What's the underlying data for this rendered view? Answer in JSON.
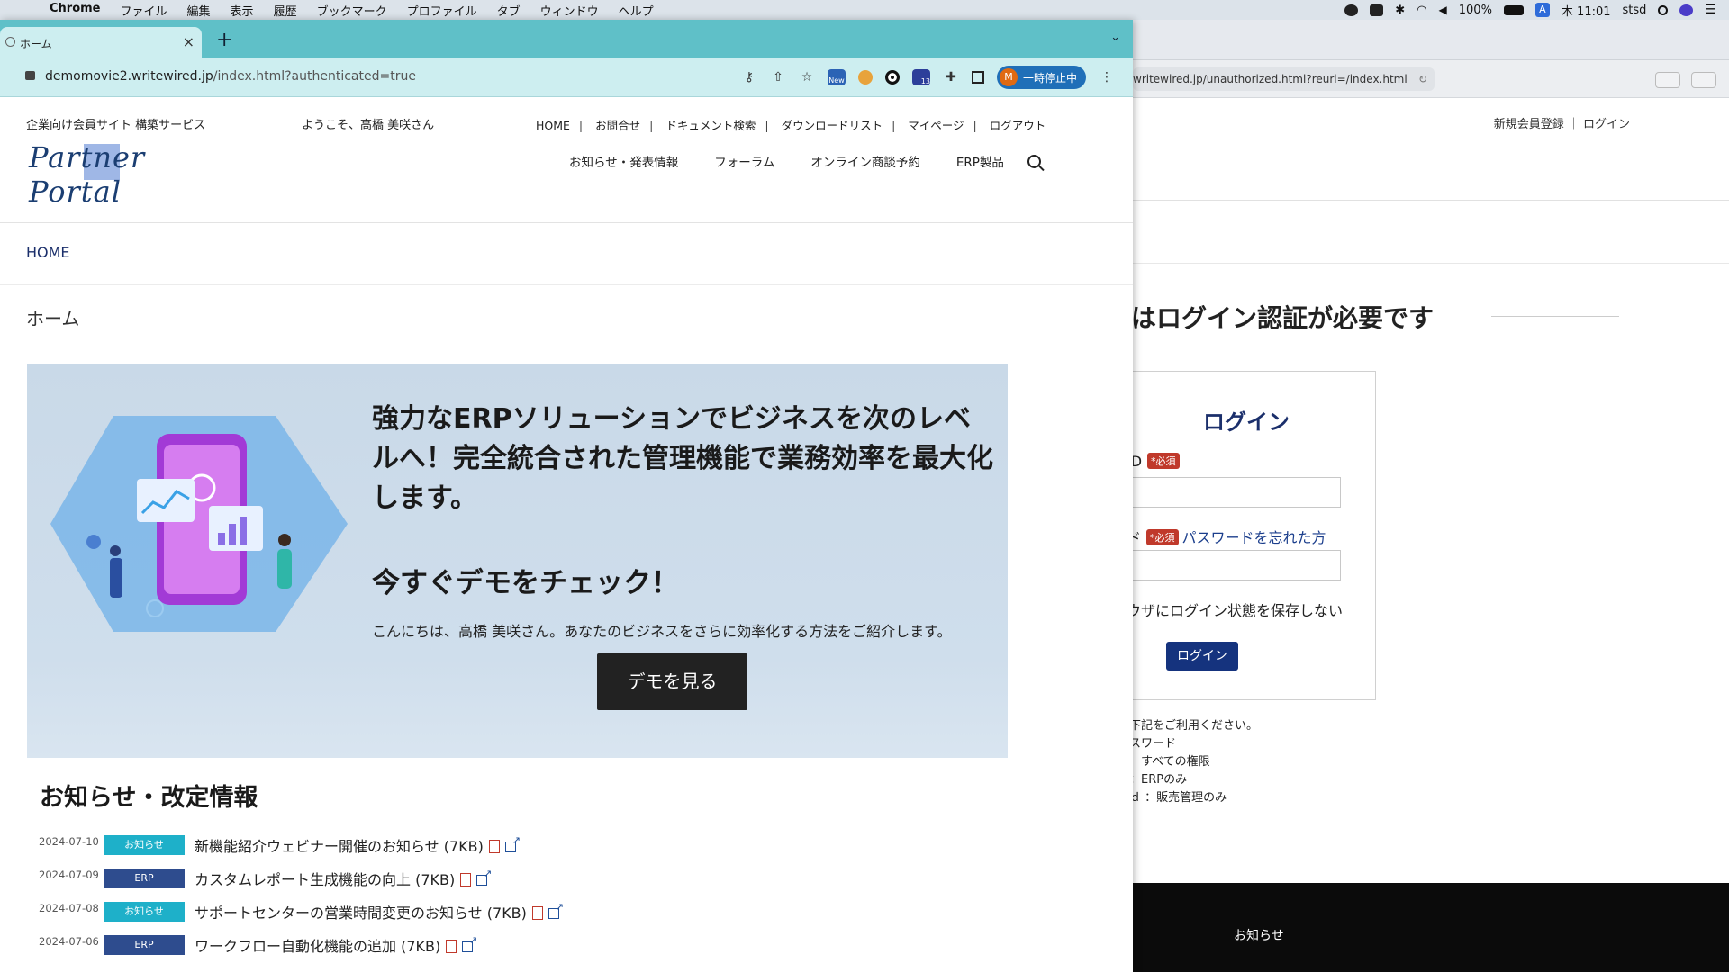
{
  "menubar": {
    "app": "Chrome",
    "menus": [
      "ファイル",
      "編集",
      "表示",
      "履歴",
      "ブックマーク",
      "プロファイル",
      "タブ",
      "ウィンドウ",
      "ヘルプ"
    ],
    "battery": "100%",
    "ime": "A",
    "clock": "木 11:01",
    "user": "stsd"
  },
  "browser": {
    "tab_title": "ホーム",
    "url_host": "demomovie2.writewired.jp",
    "url_path": "/index.html?authenticated=true",
    "profile_initial": "M",
    "profile_label": "一時停止中",
    "ext_badge_new": "New",
    "ext_badge_count": "13"
  },
  "header": {
    "tagline": "企業向け会員サイト 構築サービス",
    "logo_text": "Partner Portal",
    "welcome": "ようこそ、高橋 美咲さん",
    "topnav": [
      "HOME",
      "お問合せ",
      "ドキュメント検索",
      "ダウンロードリスト",
      "マイページ",
      "ログアウト"
    ],
    "mainnav": [
      "お知らせ・発表情報",
      "フォーラム",
      "オンライン商談予約",
      "ERP製品"
    ]
  },
  "breadcrumb": "HOME",
  "page_title": "ホーム",
  "hero": {
    "headline": "強力なERPソリューションでビジネスを次のレベルへ！完全統合された管理機能で業務効率を最大化します。",
    "subheadline": "今すぐデモをチェック！",
    "body": "こんにちは、高橋 美咲さん。あなたのビジネスをさらに効率化する方法をご紹介します。",
    "button": "デモを見る"
  },
  "news": {
    "heading": "お知らせ・改定情報",
    "items": [
      {
        "date": "2024-07-10",
        "badge": "お知らせ",
        "title": "新機能紹介ウェビナー開催のお知らせ (7KB)"
      },
      {
        "date": "2024-07-09",
        "badge": "ERP",
        "title": "カスタムレポート生成機能の向上 (7KB)"
      },
      {
        "date": "2024-07-08",
        "badge": "お知らせ",
        "title": "サポートセンターの営業時間変更のお知らせ (7KB)"
      },
      {
        "date": "2024-07-06",
        "badge": "ERP",
        "title": "ワークフロー自動化機能の追加 (7KB)"
      }
    ]
  },
  "background_window": {
    "url": "writewired.jp/unauthorized.html?reurl=/index.html",
    "topnav": "新規会員登録 ｜ ログイン",
    "heading": "覧にはログイン認証が必要です",
    "login_title": "ログイン",
    "id_label": "ID",
    "required": "*必須",
    "password_label": "ド",
    "forgot": "パスワードを忘れた方",
    "remember": "ウザにログイン状態を保存しない",
    "login_button": "ログイン",
    "notes": [
      "下記をご利用ください。",
      "スワード",
      "　すべての権限",
      "：ERPのみ",
      "ｄ ：販売管理のみ"
    ],
    "footer_link": "お知らせ"
  }
}
